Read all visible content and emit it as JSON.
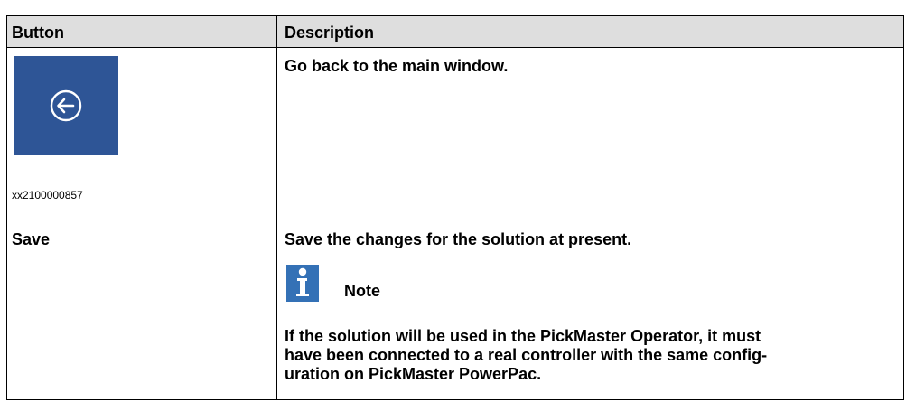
{
  "table": {
    "headers": {
      "button": "Button",
      "description": "Description"
    },
    "rows": [
      {
        "button_icon": "back-arrow-circle-icon",
        "button_icon_color": "#2e5596",
        "image_caption": "xx2100000857",
        "description": "Go back to the main window."
      },
      {
        "button_label": "Save",
        "description": "Save the changes for the solution at present.",
        "note": {
          "icon": "info-icon",
          "icon_color": "#3471b6",
          "title": "Note",
          "lines": [
            "If the solution will be used in the PickMaster Operator, it must",
            "have been connected to a real controller with the same config-",
            "uration on PickMaster PowerPac."
          ]
        }
      }
    ]
  }
}
